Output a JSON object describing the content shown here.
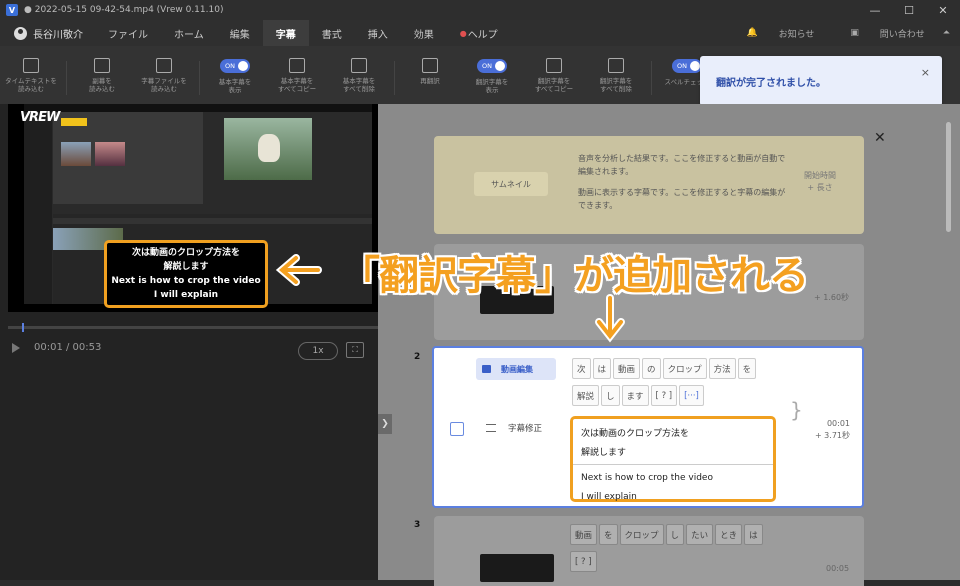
{
  "window": {
    "title": "2022-05-15 09-42-54.mp4 (Vrew 0.11.10)",
    "app_icon": "V",
    "controls": [
      "—",
      "☐",
      "✕"
    ]
  },
  "menubar": {
    "user": "長谷川敬介",
    "items": [
      "ファイル",
      "ホーム",
      "編集",
      "字幕",
      "書式",
      "挿入",
      "効果",
      "ヘルプ"
    ],
    "active": "字幕",
    "notice": "お知らせ",
    "contact": "問い合わせ"
  },
  "toolbar": {
    "tools": [
      {
        "label": "タイムテキストを\n読み込む"
      },
      {
        "label": "副幕を\n読み込む"
      },
      {
        "label": "字幕ファイルを\n読み込む"
      },
      {
        "label": "基本字幕を\n表示",
        "toggle": "ON"
      },
      {
        "label": "基本字幕を\nすべてコピー"
      },
      {
        "label": "基本字幕を\nすべて削除"
      },
      {
        "label": "再翻訳"
      },
      {
        "label": "翻訳字幕を\n表示",
        "toggle": "ON"
      },
      {
        "label": "翻訳字幕を\nすべてコピー"
      },
      {
        "label": "翻訳字幕を\nすべて削除"
      },
      {
        "label": "スペルチェック",
        "toggle": "ON"
      }
    ]
  },
  "toast": {
    "message": "翻訳が完了されました。",
    "close": "×"
  },
  "video": {
    "logo": "VREW",
    "subtitle_lines": [
      "次は動画のクロップ方法を",
      "解説します",
      "Next is how to crop the video",
      "I will explain"
    ],
    "time": "00:01 / 00:53",
    "speed": "1x",
    "fullscreen": "⛶"
  },
  "intro_card": {
    "thumbnail_label": "サムネイル",
    "text1": "音声を分析した結果です。ここを修正すると動画が自動で編集されます。",
    "text2": "動画に表示する字幕です。ここを修正すると字幕の編集ができます。",
    "time_label": "開始時間\n+ 長さ"
  },
  "card1": {
    "time": "+ 1.60秒"
  },
  "card2": {
    "number": "2",
    "tag": "動画編集",
    "words": [
      "次",
      "は",
      "動画",
      "の",
      "クロップ",
      "方法",
      "を",
      "解説",
      "し",
      "ます",
      "[ ? ]",
      "[···]"
    ],
    "fix_label": "字幕修正",
    "subtitle_jp": [
      "次は動画のクロップ方法を",
      "解説します"
    ],
    "subtitle_en": [
      "Next is how to crop the video",
      "I will explain"
    ],
    "start": "00:01",
    "duration": "+ 3.71秒"
  },
  "card3": {
    "number": "3",
    "words": [
      "動画",
      "を",
      "クロップ",
      "し",
      "たい",
      "とき",
      "は",
      "[ ? ]"
    ],
    "time": "00:05"
  },
  "callout": {
    "text": "「翻訳字幕」が追加される"
  },
  "colors": {
    "accent": "#f0a020",
    "brand_blue": "#4a6ed8"
  }
}
